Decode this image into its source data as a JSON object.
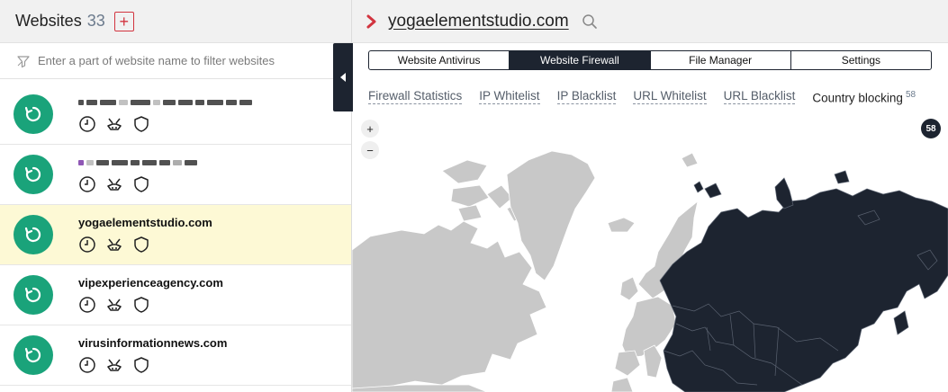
{
  "left_panel": {
    "title": "Websites",
    "count": "33",
    "add_icon": "plus-icon",
    "filter_placeholder": "Enter a part of website name to filter websites",
    "sites": [
      {
        "name": "",
        "redacted": true
      },
      {
        "name": "",
        "redacted": true
      },
      {
        "name": "yogaelementstudio.com",
        "selected": true
      },
      {
        "name": "vipexperienceagency.com"
      },
      {
        "name": "virusinformationnews.com"
      }
    ],
    "row_icons": [
      "clock-icon",
      "broom-icon",
      "shield-icon"
    ]
  },
  "right_panel": {
    "domain": "yogaelementstudio.com",
    "tabs": [
      {
        "label": "Website Antivirus"
      },
      {
        "label": "Website Firewall",
        "active": true
      },
      {
        "label": "File Manager"
      },
      {
        "label": "Settings"
      }
    ],
    "subtabs": [
      {
        "label": "Firewall Statistics"
      },
      {
        "label": "IP Whitelist"
      },
      {
        "label": "IP Blacklist"
      },
      {
        "label": "URL Whitelist"
      },
      {
        "label": "URL Blacklist"
      },
      {
        "label": "Country blocking",
        "active": true,
        "badge": "58"
      }
    ],
    "map": {
      "zoom_in": "+",
      "zoom_out": "−",
      "blocked_count": "58",
      "blocked_color": "#1d2430",
      "allowed_color": "#c8c8c8"
    }
  },
  "colors": {
    "accent_red": "#d2343f",
    "status_green": "#1aa37a",
    "selected_row": "#fdf9d5",
    "dark": "#1d2430"
  }
}
